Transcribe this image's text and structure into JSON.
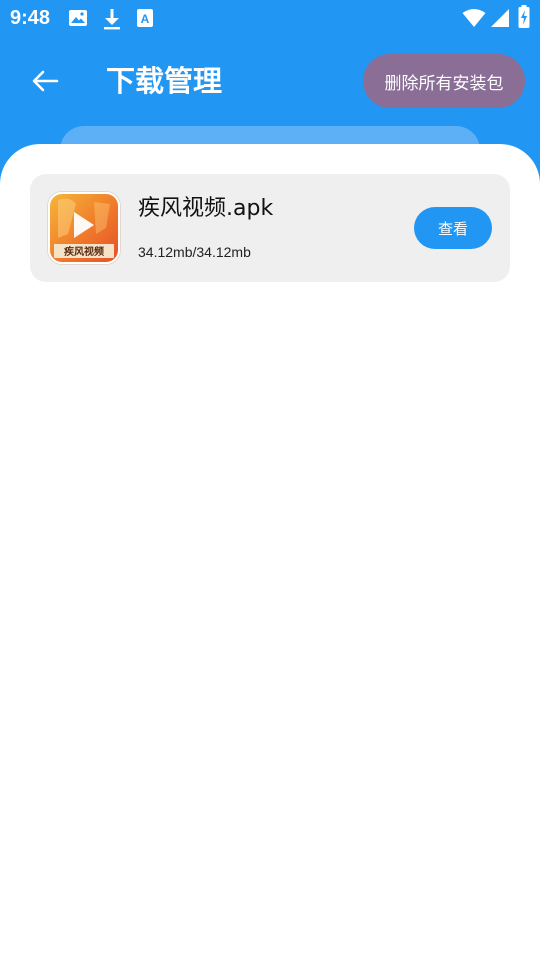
{
  "status_bar": {
    "time": "9:48",
    "left_icons": [
      "image-icon",
      "download-icon",
      "text-a-icon"
    ],
    "right_icons": [
      "wifi-icon",
      "signal-icon",
      "battery-charging-icon"
    ]
  },
  "header": {
    "title": "下载管理",
    "delete_all_label": "删除所有安装包",
    "back_icon": "arrow-left-icon"
  },
  "colors": {
    "primary": "#2196f3",
    "delete_button": "#8a6e96",
    "card_bg": "#efefef"
  },
  "downloads": [
    {
      "name": "疾风视频.apk",
      "size": "34.12mb/34.12mb",
      "action_label": "查看",
      "icon_text": "疾风视频",
      "icon": "app-play-icon"
    }
  ]
}
